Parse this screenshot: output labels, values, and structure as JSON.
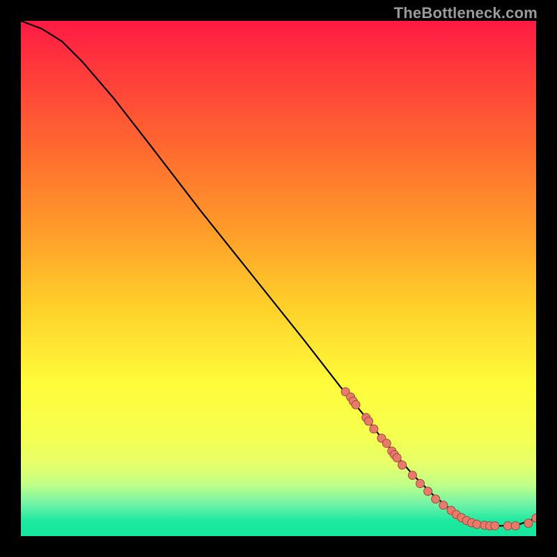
{
  "watermark": "TheBottleneck.com",
  "colors": {
    "gradient_top": "#ff1a44",
    "gradient_bottom": "#15e79c",
    "curve_stroke": "#000000",
    "dot_fill": "#e87a6c",
    "dot_stroke": "#a1463a",
    "page_bg": "#000000"
  },
  "chart_data": {
    "type": "line",
    "title": "",
    "xlabel": "",
    "ylabel": "",
    "xlim": [
      0,
      100
    ],
    "ylim": [
      0,
      100
    ],
    "series": [
      {
        "name": "main-curve",
        "x": [
          0,
          4,
          8,
          12,
          18,
          25,
          35,
          45,
          55,
          62,
          67,
          70,
          73,
          76,
          80,
          83,
          85,
          88,
          92,
          96,
          100
        ],
        "y": [
          100,
          98.5,
          96,
          92,
          85,
          76,
          63,
          50.5,
          38,
          29,
          23,
          19,
          15.5,
          12,
          8,
          5.5,
          4,
          2.5,
          2,
          2,
          3.5
        ]
      }
    ],
    "scatter": [
      {
        "name": "highlight-dots",
        "points": [
          [
            63,
            28
          ],
          [
            64,
            27
          ],
          [
            64.5,
            26.2
          ],
          [
            65,
            25.5
          ],
          [
            67,
            23
          ],
          [
            67.5,
            22.3
          ],
          [
            68.5,
            20.8
          ],
          [
            70,
            19
          ],
          [
            71,
            18
          ],
          [
            72,
            16.5
          ],
          [
            72.5,
            15.8
          ],
          [
            73,
            15.2
          ],
          [
            74,
            13.8
          ],
          [
            76,
            11.8
          ],
          [
            77.5,
            10.2
          ],
          [
            79,
            8.7
          ],
          [
            80.5,
            7.2
          ],
          [
            82,
            6
          ],
          [
            83.5,
            5
          ],
          [
            84.5,
            4.2
          ],
          [
            85.5,
            3.6
          ],
          [
            86.5,
            3
          ],
          [
            87.5,
            2.6
          ],
          [
            88.5,
            2.3
          ],
          [
            90,
            2.1
          ],
          [
            91,
            2
          ],
          [
            92,
            2
          ],
          [
            94.5,
            2
          ],
          [
            96,
            2
          ],
          [
            98.5,
            2.5
          ],
          [
            100,
            3.5
          ]
        ]
      }
    ]
  }
}
